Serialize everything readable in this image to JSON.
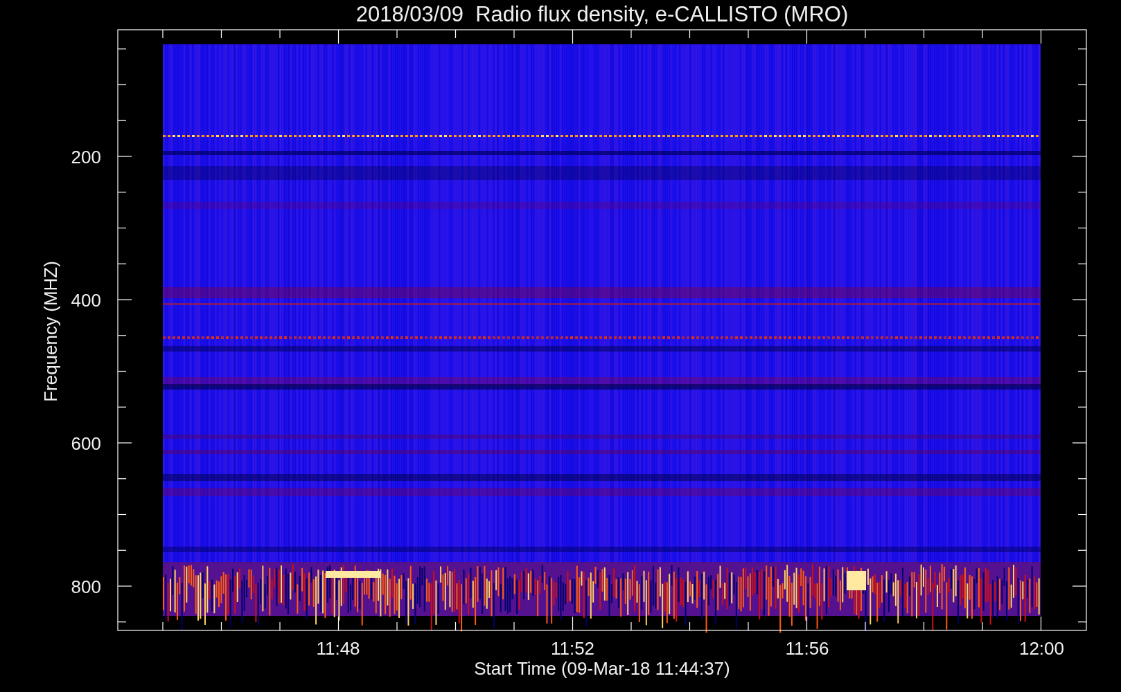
{
  "title": "2018/03/09  Radio flux density, e-CALLISTO (MRO)",
  "y_axis": {
    "label": "Frequency (MHZ)",
    "ticks": [
      "200",
      "400",
      "600",
      "800"
    ]
  },
  "x_axis": {
    "label": "Start Time (09-Mar-18 11:44:37)",
    "ticks": [
      "11:48",
      "11:52",
      "11:56",
      "12:00"
    ]
  }
}
